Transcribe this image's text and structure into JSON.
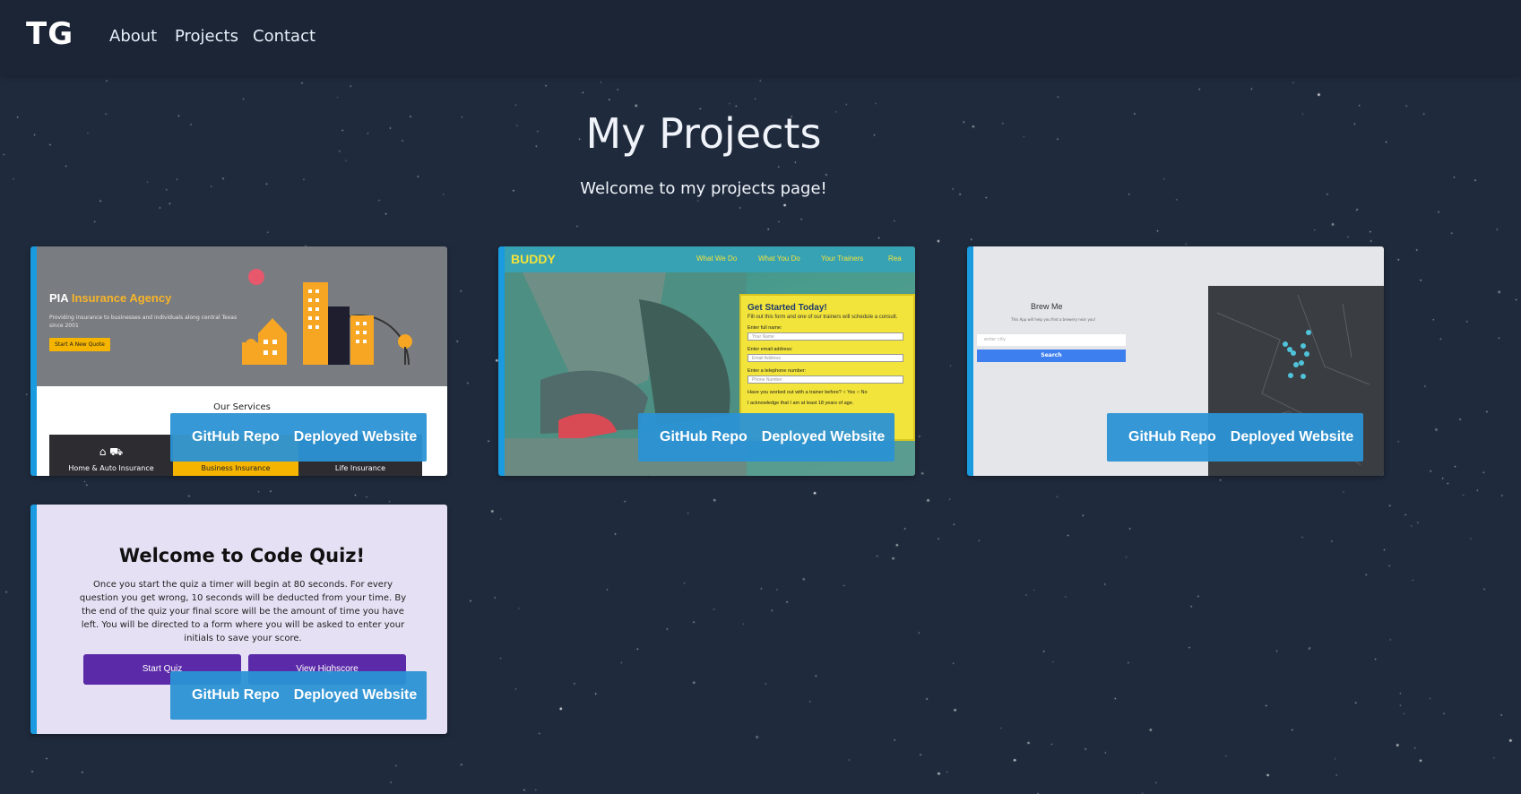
{
  "nav": {
    "brand": "TG",
    "links": [
      "About",
      "Projects",
      "Contact"
    ]
  },
  "main": {
    "title": "My Projects",
    "subtitle": "Welcome to my projects page!"
  },
  "card_buttons": {
    "github": "GitHub Repo",
    "deployed": "Deployed Website"
  },
  "projects": [
    {
      "name": "PIA Insurance Agency",
      "logo_plain": "PIA",
      "logo_accent": "Insurance Agency",
      "description": "Providing insurance to businesses and individuals along central Texas since 2001",
      "cta": "Start A New Quote",
      "section_title": "Our Services",
      "services": [
        "Home & Auto Insurance",
        "Business Insurance",
        "Life Insurance"
      ]
    },
    {
      "name": "BUDDY",
      "logo": "BUDDY",
      "nav": [
        "What We Do",
        "What You Do",
        "Your Trainers",
        "Rea"
      ],
      "form_title": "Get Started Today!",
      "form_sub": "Fill out this form and one of our trainers will schedule a consult.",
      "fields": [
        {
          "label": "Enter full name:",
          "placeholder": "Your Name"
        },
        {
          "label": "Enter email address:",
          "placeholder": "Email Address"
        },
        {
          "label": "Enter a telephone number:",
          "placeholder": "Phone Number"
        }
      ],
      "question": "Have you worked out with a trainer before?",
      "options": [
        "Yes",
        "No"
      ],
      "acknowledge": "I acknowledge that I am at least 18 years of age."
    },
    {
      "name": "Brew Me",
      "title": "Brew Me",
      "tagline": "This App will help you find a brewery near you!",
      "input_placeholder": "enter city",
      "button": "Search"
    },
    {
      "name": "Code Quiz",
      "title": "Welcome to Code Quiz!",
      "body": "Once you start the quiz a timer will begin at 80 seconds. For every question you get wrong, 10 seconds will be deducted from your time. By the end of the quiz your final score will be the amount of time you have left. You will be directed to a form where you will be asked to enter your initials to save your score.",
      "start_button": "Start Quiz",
      "highscore_button": "View Highscore"
    }
  ],
  "colors": {
    "background": "#1f2a3c",
    "navbar": "#1b2536",
    "accent": "#1a9bdf",
    "button": "#2b92d4"
  }
}
